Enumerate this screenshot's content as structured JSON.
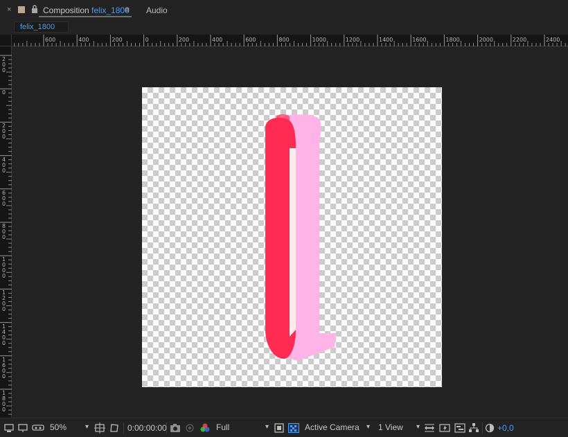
{
  "panel": {
    "close_glyph": "×",
    "title_prefix": "Composition",
    "comp_name": "felix_1800",
    "menu_glyph": "≡",
    "audio_tab": "Audio",
    "subtab": "felix_1800"
  },
  "ruler_top": [
    "600",
    "400",
    "200",
    "0",
    "200",
    "400",
    "600",
    "800",
    "1000",
    "1200",
    "1400",
    "1600",
    "1800",
    "2000",
    "2200",
    "2400"
  ],
  "ruler_left": [
    "200",
    "0",
    "200",
    "400",
    "600",
    "800",
    "1000",
    "1200",
    "1400",
    "1600",
    "1800"
  ],
  "toolbar": {
    "zoom": "50%",
    "timecode": "0:00:00:00",
    "resolution": "Full",
    "camera": "Active Camera",
    "views": "1 View",
    "exposure": "+0,0"
  },
  "icons": [
    "composition-swatch-icon",
    "lock-icon",
    "camera-snapshot-icon",
    "color-channels-icon",
    "region-of-interest-icon",
    "transparency-grid-icon",
    "reset-exposure-icon",
    "flowchart-icon"
  ],
  "colors": {
    "accent": "#4a9df0",
    "shape_front": "#ff2b52",
    "shape_back": "#ffb3e6"
  }
}
